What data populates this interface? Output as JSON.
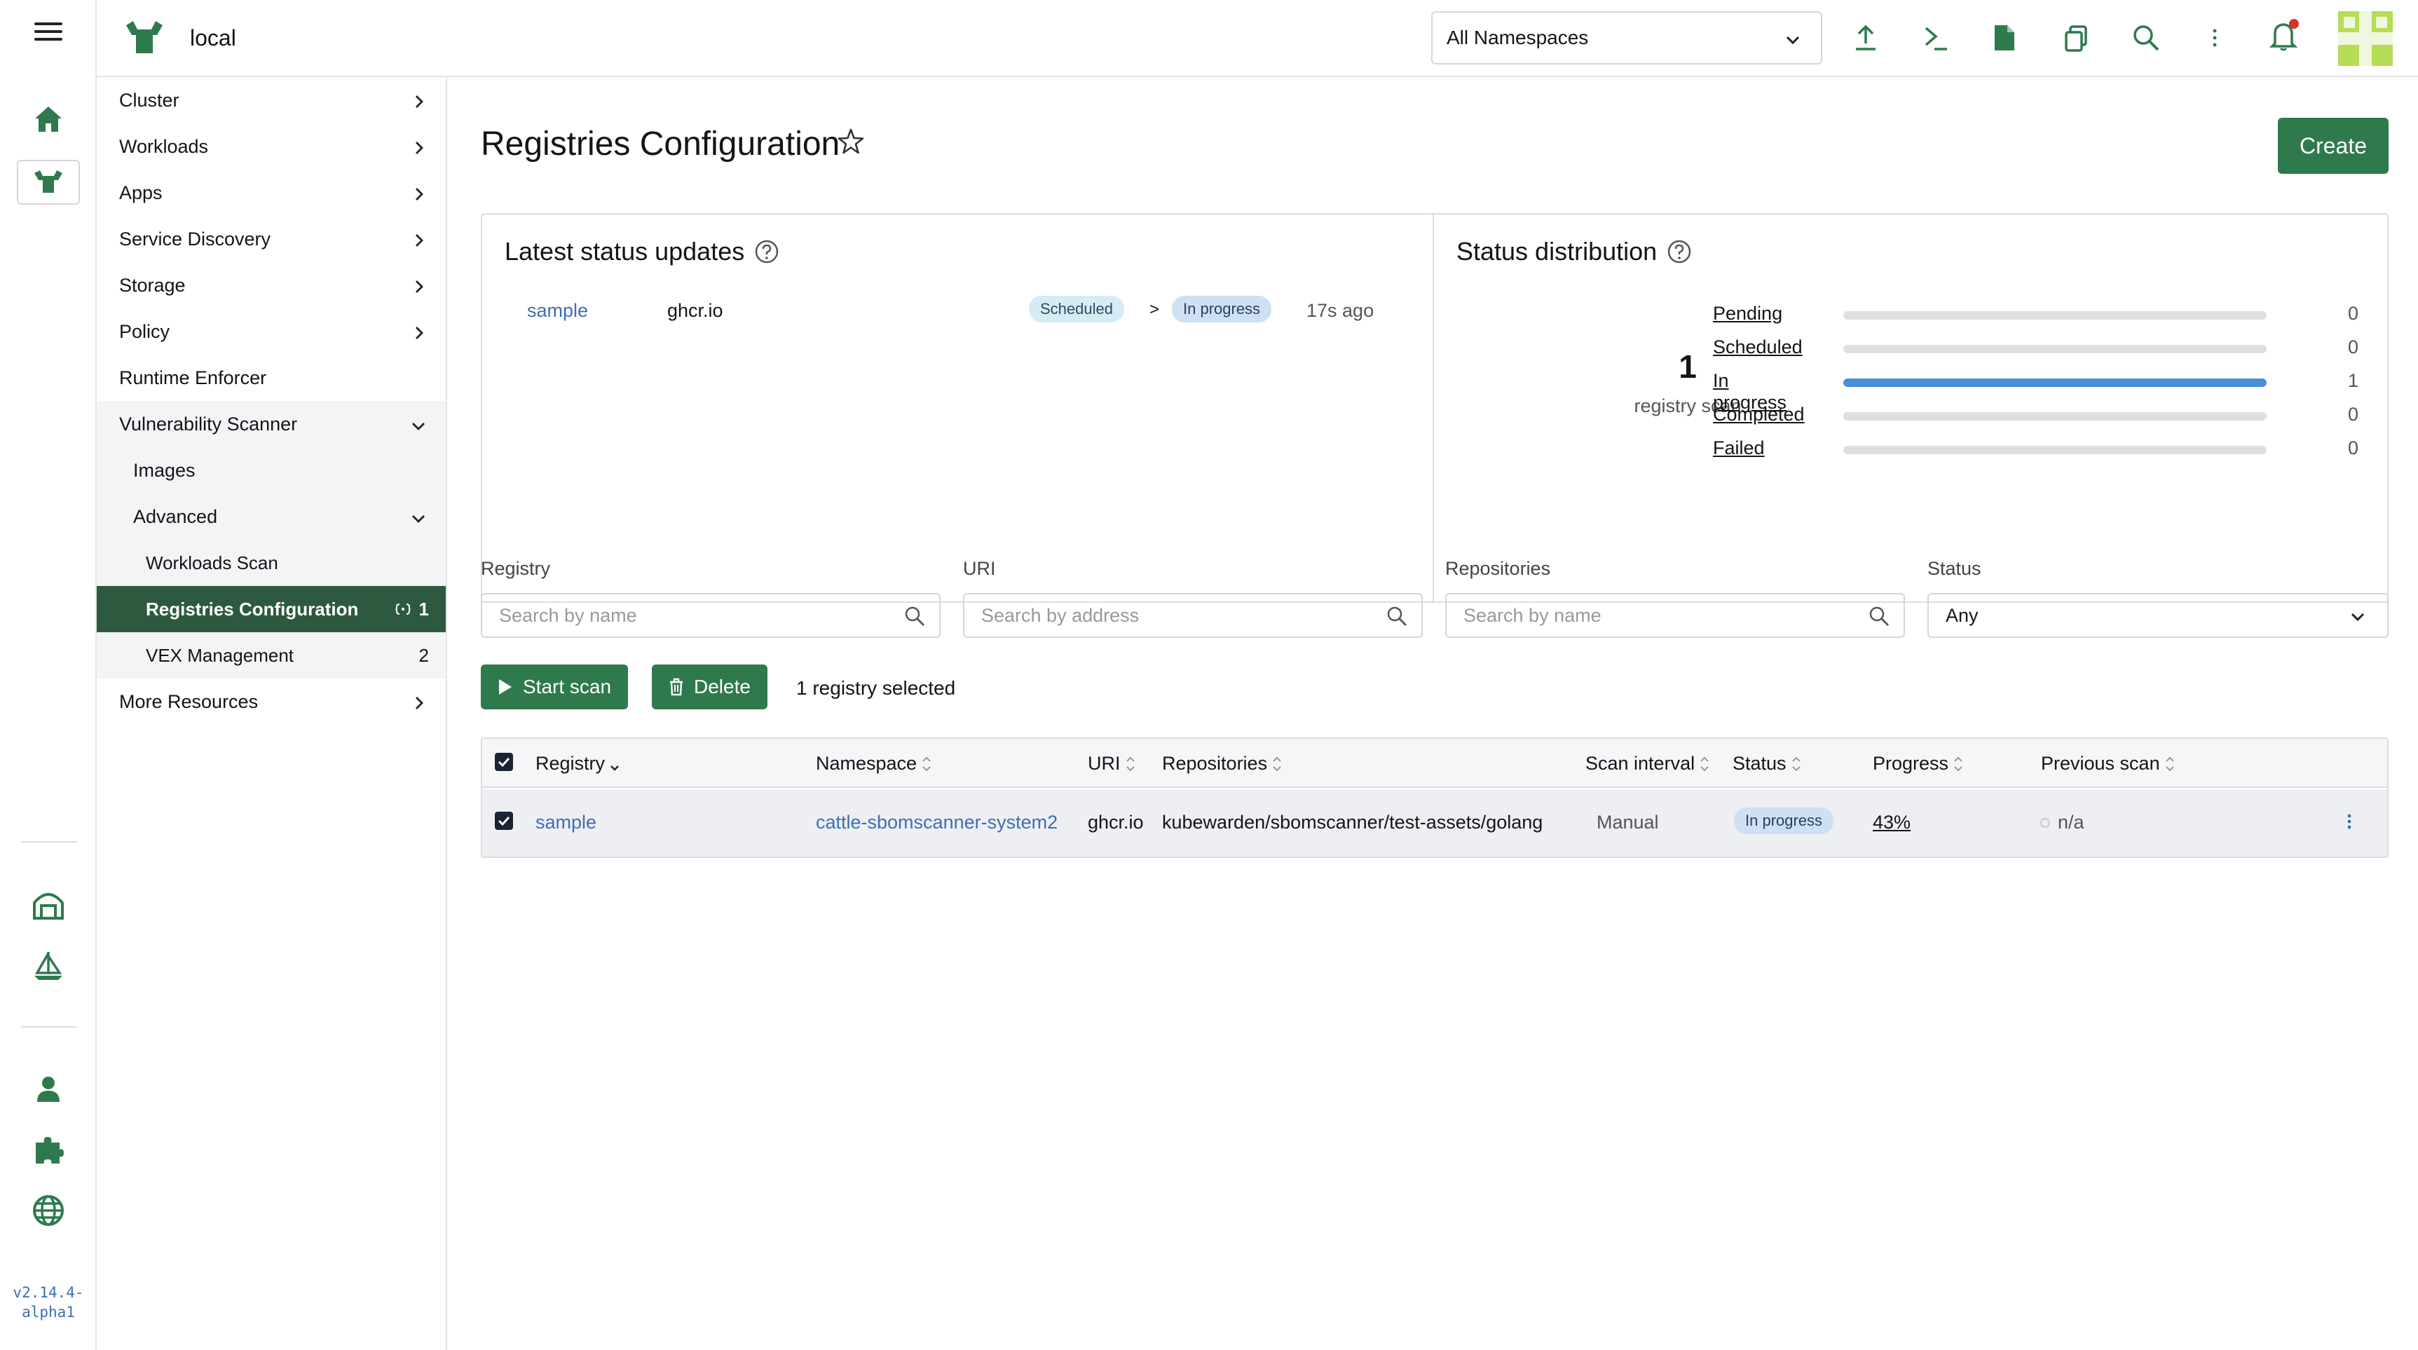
{
  "header": {
    "cluster_name": "local",
    "namespace_select": "All Namespaces"
  },
  "rail": {
    "version": "v2.14.4-alpha1"
  },
  "sidenav": {
    "items": [
      {
        "label": "Cluster"
      },
      {
        "label": "Workloads"
      },
      {
        "label": "Apps"
      },
      {
        "label": "Service Discovery"
      },
      {
        "label": "Storage"
      },
      {
        "label": "Policy"
      },
      {
        "label": "Runtime Enforcer"
      },
      {
        "label": "Vulnerability Scanner"
      },
      {
        "label": "Images"
      },
      {
        "label": "Advanced"
      },
      {
        "label": "Workloads Scan"
      },
      {
        "label": "Registries Configuration",
        "count": "1"
      },
      {
        "label": "VEX Management",
        "count": "2"
      },
      {
        "label": "More Resources"
      }
    ]
  },
  "page": {
    "title": "Registries Configuration",
    "create_label": "Create"
  },
  "status_updates": {
    "title": "Latest status updates",
    "row": {
      "registry": "sample",
      "uri": "ghcr.io",
      "from": "Scheduled",
      "arrow": ">",
      "to": "In progress",
      "time": "17s ago"
    }
  },
  "status_distribution": {
    "title": "Status distribution",
    "total": "1",
    "total_label": "registry scan",
    "rows": [
      {
        "label": "Pending",
        "count": "0",
        "fraction": 0
      },
      {
        "label": "Scheduled",
        "count": "0",
        "fraction": 0
      },
      {
        "label": "In progress",
        "count": "1",
        "fraction": 1
      },
      {
        "label": "Completed",
        "count": "0",
        "fraction": 0
      },
      {
        "label": "Failed",
        "count": "0",
        "fraction": 0
      }
    ]
  },
  "filters": {
    "registry": {
      "label": "Registry",
      "placeholder": "Search by name"
    },
    "uri": {
      "label": "URI",
      "placeholder": "Search by address"
    },
    "repositories": {
      "label": "Repositories",
      "placeholder": "Search by name"
    },
    "status": {
      "label": "Status",
      "value": "Any"
    }
  },
  "actions": {
    "start_scan": "Start scan",
    "delete": "Delete",
    "selected_text": "1 registry selected"
  },
  "table": {
    "headers": [
      "Registry",
      "Namespace",
      "URI",
      "Repositories",
      "Scan interval",
      "Status",
      "Progress",
      "Previous scan"
    ],
    "rows": [
      {
        "registry": "sample",
        "namespace": "cattle-sbomscanner-system2",
        "uri": "ghcr.io",
        "repositories": "kubewarden/sbomscanner/test-assets/golang",
        "scan_interval": "Manual",
        "status": "In progress",
        "progress": "43%",
        "previous_scan": "n/a"
      }
    ]
  },
  "colors": {
    "accent_green": "#2f7a4d",
    "active_nav": "#2d5a3f",
    "link_blue": "#3d6fb4",
    "progress_blue": "#4a8ed8",
    "notification_dot": "#d0342c"
  }
}
